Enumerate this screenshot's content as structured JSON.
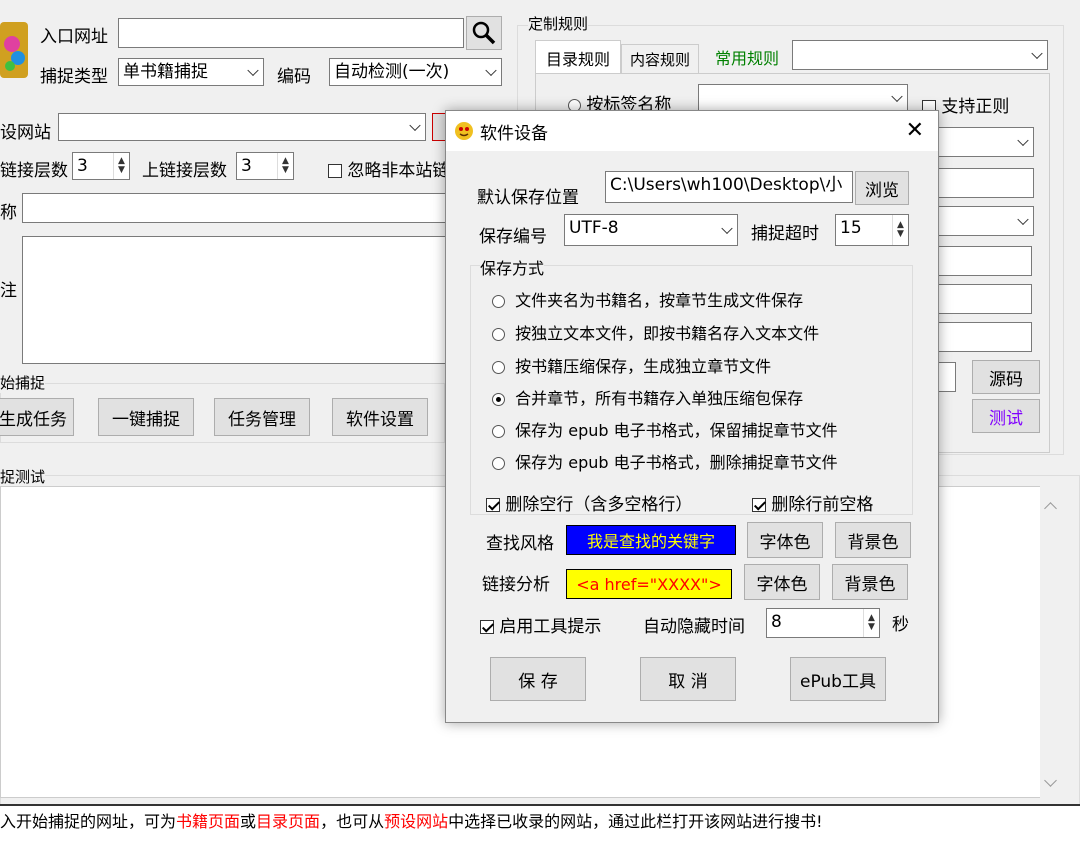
{
  "main": {
    "entry_url_label": "入口网址",
    "entry_url_value": "",
    "capture_type_label": "捕捉类型",
    "capture_type_value": "单书籍捕捉",
    "encoding_label": "编码",
    "encoding_value": "自动检测(一次)",
    "preset_site_label": "设网站",
    "preset_site_value": "",
    "link_depth_label": "链接层数",
    "link_depth_value": "3",
    "up_link_depth_label": "上链接层数",
    "up_link_depth_value": "3",
    "ignore_offsite_label": "忽略非本站链",
    "name_label": "称",
    "note_label": "注",
    "capture_group_label": "始捕捉",
    "buttons": {
      "generate_task": "生成任务",
      "one_click_capture": "一键捕捉",
      "task_manage": "任务管理",
      "software_settings": "软件设置"
    },
    "test_group_label": "捉测试",
    "status_segments": [
      {
        "text": "入开始捕捉的网址，可为",
        "red": false
      },
      {
        "text": "书籍页面",
        "red": true
      },
      {
        "text": "或",
        "red": false
      },
      {
        "text": "目录页面",
        "red": true
      },
      {
        "text": "，也可从",
        "red": false
      },
      {
        "text": "预设网站",
        "red": true
      },
      {
        "text": "中选择已收录的网站，通过此栏打开该网站进行搜书!",
        "red": false
      }
    ]
  },
  "rules": {
    "group_label": "定制规则",
    "tab_catalog": "目录规则",
    "tab_content": "内容规则",
    "common_rules_label": "常用规则",
    "by_tag_label": "按标签名称",
    "regex_label": "支持正则",
    "source_button": "源码",
    "test_button": "测试"
  },
  "dialog": {
    "title": "软件设备",
    "default_save_label": "默认保存位置",
    "default_save_value": "C:\\Users\\wh100\\Desktop\\小",
    "browse_button": "浏览",
    "save_encoding_label": "保存编号",
    "save_encoding_value": "UTF-8",
    "timeout_label": "捕捉超时",
    "timeout_value": "15",
    "save_mode_label": "保存方式",
    "save_modes": [
      {
        "label": "文件夹名为书籍名，按章节生成文件保存",
        "selected": false
      },
      {
        "label": "按独立文本文件，即按书籍名存入文本文件",
        "selected": false
      },
      {
        "label": "按书籍压缩保存，生成独立章节文件",
        "selected": false
      },
      {
        "label": "合并章节，所有书籍存入单独压缩包保存",
        "selected": true
      },
      {
        "label": "保存为 epub 电子书格式，保留捕捉章节文件",
        "selected": false
      },
      {
        "label": "保存为 epub 电子书格式，删除捕捉章节文件",
        "selected": false
      }
    ],
    "delete_empty_lines": "删除空行（含多空格行）",
    "delete_leading_spaces": "删除行前空格",
    "find_style_label": "查找风格",
    "find_style_sample": "我是查找的关键字",
    "link_analysis_label": "链接分析",
    "link_analysis_sample": "<a href=\"XXXX\">",
    "font_color_button": "字体色",
    "bg_color_button": "背景色",
    "enable_tooltip_label": "启用工具提示",
    "auto_hide_label": "自动隐藏时间",
    "auto_hide_value": "8",
    "seconds_label": "秒",
    "save_button": "保 存",
    "cancel_button": "取 消",
    "epub_tool_button": "ePub工具"
  },
  "colors": {
    "find_bg": "#0000ff",
    "find_fg": "#ffff00",
    "link_bg": "#ffff00",
    "link_fg": "#ff0000",
    "common_rules": "#008000",
    "test_button": "#8000ff"
  }
}
